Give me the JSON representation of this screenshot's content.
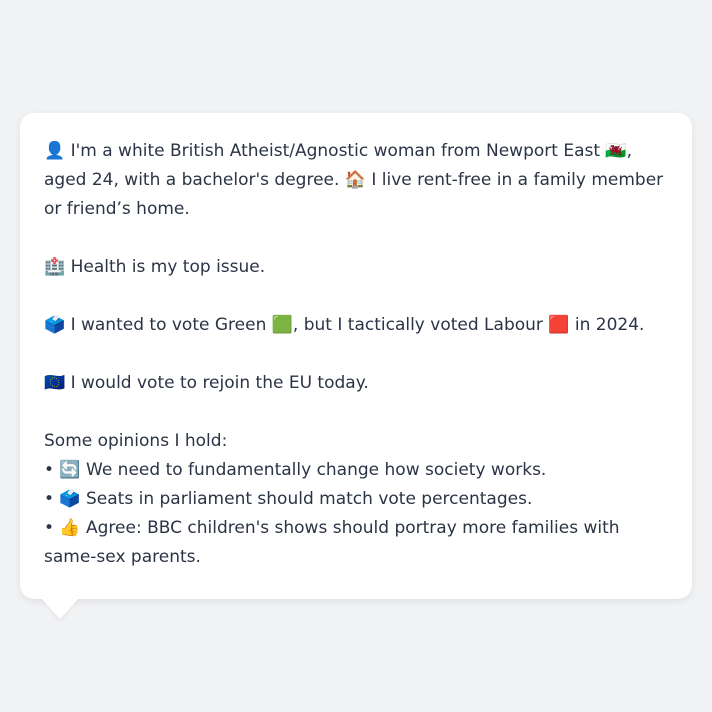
{
  "profile": {
    "intro": "👤 I'm a white British Atheist/Agnostic woman from Newport East 🏴󠁧󠁢󠁷󠁬󠁳󠁿, aged 24, with a bachelor's degree. 🏠 I live rent-free in a family member or friend’s home.",
    "top_issue": "🏥 Health is my top issue.",
    "vote": "🗳️ I wanted to vote Green 🟩, but I tactically voted Labour 🟥 in 2024.",
    "eu": "🇪🇺 I would vote to rejoin the EU today.",
    "opinions_heading": "Some opinions I hold:",
    "opinions": [
      "• 🔄 We need to fundamentally change how society works.",
      "• 🗳️ Seats in parliament should match vote percentages.",
      "• 👍 Agree: BBC children's shows should portray more families with same-sex parents."
    ]
  }
}
